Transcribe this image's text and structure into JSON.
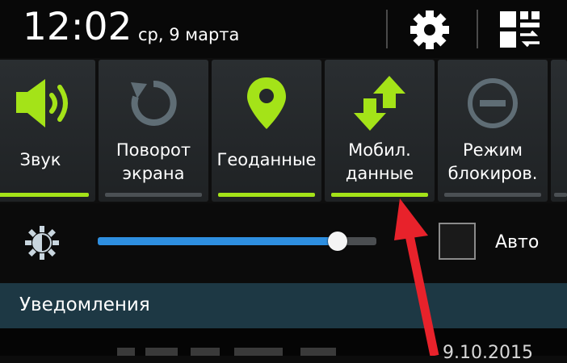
{
  "status_bar": {
    "time": "12:02",
    "date": "ср, 9 марта",
    "settings_icon": "gear-icon",
    "edit_toggles_icon": "grid-sort-icon"
  },
  "quick_toggles": [
    {
      "label_line1": "Звук",
      "label_line2": "",
      "icon": "volume-icon",
      "active": true
    },
    {
      "label_line1": "Поворот",
      "label_line2": "экрана",
      "icon": "rotate-icon",
      "active": false
    },
    {
      "label_line1": "Геоданные",
      "label_line2": "",
      "icon": "location-pin-icon",
      "active": true
    },
    {
      "label_line1": "Мобил.",
      "label_line2": "данные",
      "icon": "mobile-data-arrows-icon",
      "active": true
    },
    {
      "label_line1": "Режим",
      "label_line2": "блокиров.",
      "icon": "block-mode-icon",
      "active": false
    }
  ],
  "brightness": {
    "icon": "brightness-icon",
    "level": 0.86,
    "auto_checked": false,
    "auto_label": "Авто"
  },
  "notifications": {
    "title": "Уведомления",
    "partial_text": "9.10.2015"
  },
  "colors": {
    "active_green": "#a4e318",
    "inactive_gray": "#5f6d75",
    "slider_blue": "#2e8fe0",
    "notif_header": "#1d3844",
    "annotation_red": "#e8222b"
  }
}
